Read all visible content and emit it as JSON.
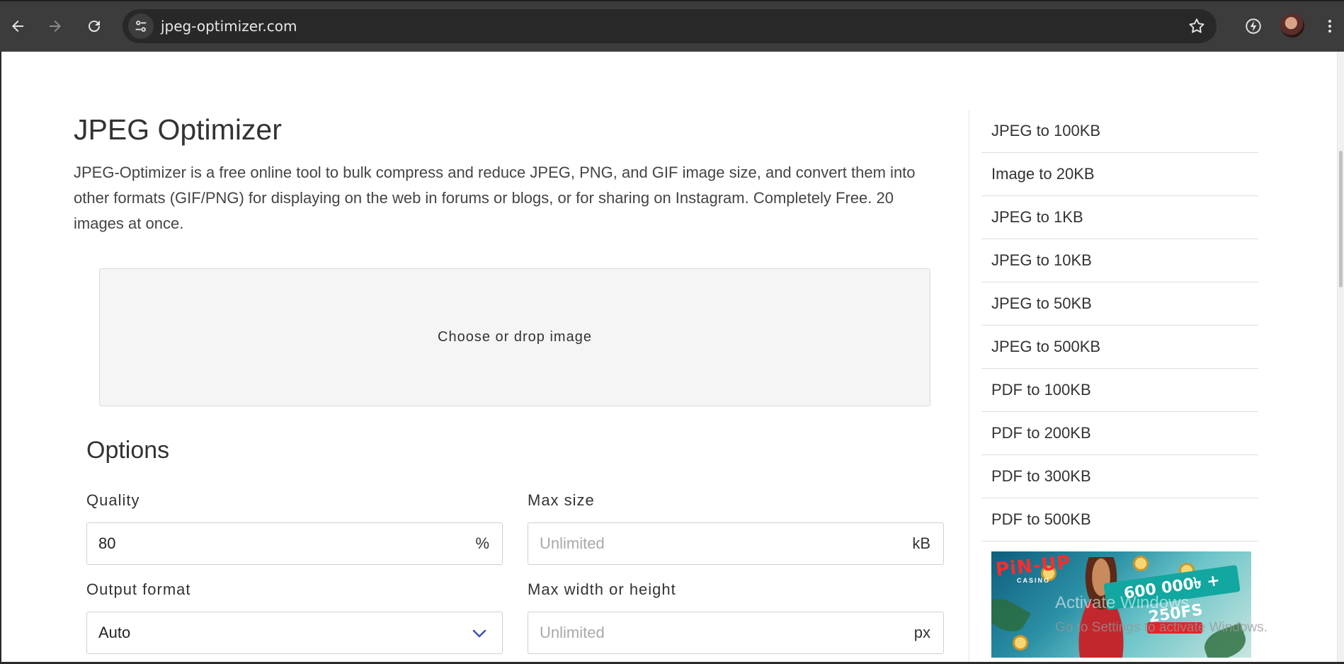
{
  "browser": {
    "url": "jpeg-optimizer.com",
    "icons": {
      "back": "arrow-left-icon",
      "forward": "arrow-right-icon",
      "reload": "reload-icon",
      "site_info": "tune-icon",
      "bookmark": "star-icon",
      "extension": "lightning-icon",
      "menu": "kebab-menu-icon"
    }
  },
  "main": {
    "title": "JPEG Optimizer",
    "intro": "JPEG-Optimizer is a free online tool to bulk compress and reduce JPEG, PNG, and GIF image size, and convert them into other formats (GIF/PNG) for displaying on the web in forums or blogs, or for sharing on Instagram. Completely Free. 20 images at once.",
    "dropzone_label": "Choose or drop image"
  },
  "options": {
    "title": "Options",
    "quality": {
      "label": "Quality",
      "value": "80",
      "suffix": "%"
    },
    "max_size": {
      "label": "Max size",
      "placeholder": "Unlimited",
      "suffix": "kB"
    },
    "output_format": {
      "label": "Output format",
      "value": "Auto"
    },
    "max_dimension": {
      "label": "Max width or height",
      "placeholder": "Unlimited",
      "suffix": "px"
    }
  },
  "sidebar": {
    "items": [
      "JPEG to 100KB",
      "Image to 20KB",
      "JPEG to 1KB",
      "JPEG to 10KB",
      "JPEG to 50KB",
      "JPEG to 500KB",
      "PDF to 100KB",
      "PDF to 200KB",
      "PDF to 300KB",
      "PDF to 500KB"
    ]
  },
  "ad": {
    "logo": "PiN-UP",
    "logo_sub": "CASINO",
    "offer": "600 000৳ + 250FS"
  },
  "watermark": {
    "line1": "Activate Windows",
    "line2": "Go to Settings to activate Windows."
  },
  "colors": {
    "chrome_bg": "#3c3c3c",
    "omnibox_bg": "#282828",
    "accent_chevron": "#3f51b5"
  }
}
